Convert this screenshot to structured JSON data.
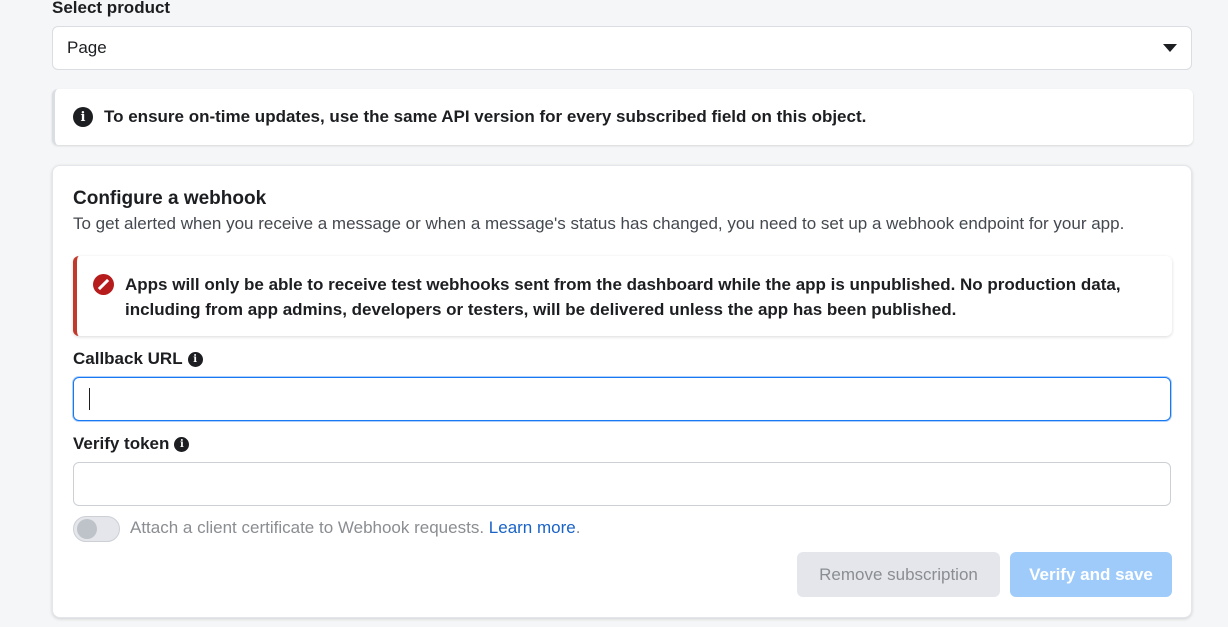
{
  "product": {
    "label": "Select product",
    "selected": "Page"
  },
  "info_banner": {
    "icon": "info-icon",
    "text": "To ensure on-time updates, use the same API version for every subscribed field on this object."
  },
  "webhook": {
    "title": "Configure a webhook",
    "description": "To get alerted when you receive a message or when a message's status has changed, you need to set up a webhook endpoint for your app.",
    "error": {
      "icon": "blocked-icon",
      "text": "Apps will only be able to receive test webhooks sent from the dashboard while the app is unpublished. No production data, including from app admins, developers or testers, will be delivered unless the app has been published."
    },
    "callback_url": {
      "label": "Callback URL",
      "value": ""
    },
    "verify_token": {
      "label": "Verify token",
      "value": ""
    },
    "certificate": {
      "text": "Attach a client certificate to Webhook requests.",
      "link": "Learn more",
      "suffix": ".",
      "enabled": false
    },
    "buttons": {
      "remove": "Remove subscription",
      "verify": "Verify and save"
    }
  },
  "colors": {
    "accent": "#1877f2",
    "error": "#b71c1c",
    "verify_disabled": "#9fcbfa"
  }
}
